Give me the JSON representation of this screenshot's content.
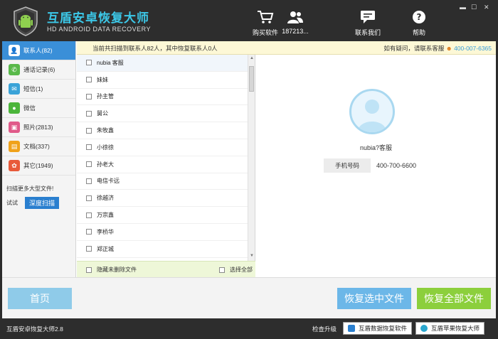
{
  "header": {
    "title": "互盾安卓恢复大师",
    "subtitle": "HD ANDROID DATA RECOVERY",
    "nav": [
      {
        "label": "购买软件",
        "icon": "cart-icon"
      },
      {
        "label": "187213...",
        "icon": "user-icon"
      },
      {
        "label": "联系我们",
        "icon": "chat-icon"
      },
      {
        "label": "帮助",
        "icon": "help-icon"
      }
    ],
    "window": {
      "minimize": "▬",
      "maximize": "☐",
      "close": "✕"
    }
  },
  "sidebar": {
    "items": [
      {
        "label": "联系人(82)",
        "icon": "contacts-icon",
        "color": "#3a8fd8"
      },
      {
        "label": "通话记录(6)",
        "icon": "phone-icon",
        "color": "#59b94a"
      },
      {
        "label": "短信(1)",
        "icon": "sms-icon",
        "color": "#3aa3d8"
      },
      {
        "label": "微信",
        "icon": "wechat-icon",
        "color": "#4bb53a"
      },
      {
        "label": "照片(2813)",
        "icon": "photo-icon",
        "color": "#e05a8a"
      },
      {
        "label": "文档(337)",
        "icon": "document-icon",
        "color": "#f0a21a"
      },
      {
        "label": "其它(1949)",
        "icon": "other-icon",
        "color": "#e85a3a"
      }
    ],
    "scan_more": "扫描更多大型文件!",
    "try_label": "试试",
    "deep_scan": "深度扫描"
  },
  "infobar": {
    "message": "当前共扫描到联系人82人，其中恢复联系人0人",
    "help_text": "如有疑问，请联系客服",
    "phone": "400-007-6365"
  },
  "contacts": [
    "nubia 客服",
    "妹妹",
    "孙主管",
    "舅公",
    "朱牧鑫",
    "小徐徐",
    "孙老大",
    "电信卡远",
    "徐越济",
    "万宗鑫",
    "李桥华",
    "郑正城"
  ],
  "list_footer": {
    "hide_deleted": "隐藏未删除文件",
    "select_all": "选择全部"
  },
  "detail": {
    "name": "nubia?客服",
    "phone_label": "手机号码",
    "phone_value": "400-700-6600"
  },
  "buttons": {
    "home": "首页",
    "recover_selected": "恢复选中文件",
    "recover_all": "恢复全部文件"
  },
  "status": {
    "version": "互盾安卓恢复大师2.8",
    "upgrade": "检查升级",
    "data_recovery": "互盾数据恢复软件",
    "apple_recovery": "互盾苹果恢复大师"
  },
  "colors": {
    "accent": "#3a8fd8",
    "title_color": "#3cc8e8",
    "recover_all": "#8ccf3c",
    "recover_selected": "#6cb7e8"
  }
}
